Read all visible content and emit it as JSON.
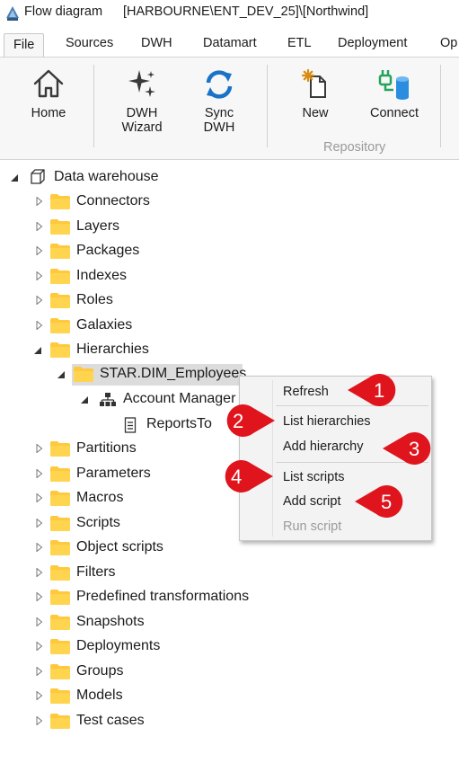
{
  "window": {
    "title": "Flow diagram",
    "connection": "[HARBOURNE\\ENT_DEV_25]\\[Northwind]"
  },
  "ribbon_tabs": [
    "File",
    "Sources",
    "DWH",
    "Datamart",
    "ETL",
    "Deployment",
    "Op"
  ],
  "active_tab": "File",
  "ribbon": {
    "home_label": "Home",
    "dwh_wizard_label_line1": "DWH",
    "dwh_wizard_label_line2": "Wizard",
    "sync_dwh_label_line1": "Sync",
    "sync_dwh_label_line2": "DWH",
    "new_label": "New",
    "connect_label": "Connect",
    "repository_group": "Repository"
  },
  "tree": {
    "root": "Data warehouse",
    "items": [
      "Connectors",
      "Layers",
      "Packages",
      "Indexes",
      "Roles",
      "Galaxies",
      "Hierarchies"
    ],
    "hierarchy_child": "STAR.DIM_Employees",
    "hierarchy_grandchild": "Account Manager",
    "hierarchy_leaf": "ReportsTo",
    "items_after": [
      "Partitions",
      "Parameters",
      "Macros",
      "Scripts",
      "Object scripts",
      "Filters",
      "Predefined transformations",
      "Snapshots",
      "Deployments",
      "Groups",
      "Models",
      "Test cases"
    ]
  },
  "context_menu": {
    "refresh": "Refresh",
    "list_hierarchies": "List hierarchies",
    "add_hierarchy": "Add hierarchy",
    "list_scripts": "List scripts",
    "add_script": "Add script",
    "run_script": "Run script",
    "run_script_enabled": false
  },
  "callouts": {
    "c1": "1",
    "c2": "2",
    "c3": "3",
    "c4": "4",
    "c5": "5",
    "color": "#e0141c"
  }
}
